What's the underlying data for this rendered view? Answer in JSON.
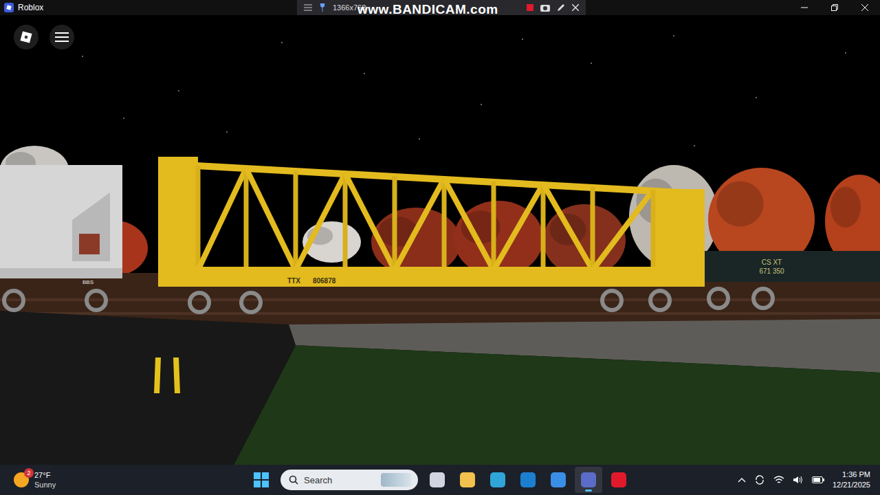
{
  "window": {
    "title": "Roblox"
  },
  "recorder": {
    "resolution": "1366x768",
    "watermark": "www.BANDICAM.com",
    "recording": true
  },
  "game": {
    "cars": [
      {
        "kind": "hopper",
        "mark": "BBS",
        "number": ""
      },
      {
        "kind": "centerbeam",
        "mark": "TTX",
        "number": "806878"
      },
      {
        "kind": "tank",
        "mark": "CS XT",
        "number": "671 350"
      }
    ]
  },
  "taskbar": {
    "weather": {
      "temp": "27°F",
      "condition": "Sunny",
      "badge": "2"
    },
    "search": {
      "placeholder": "Search"
    },
    "apps": [
      {
        "name": "task-view",
        "selected": false
      },
      {
        "name": "file-explorer",
        "selected": false
      },
      {
        "name": "edge",
        "selected": false
      },
      {
        "name": "hp",
        "selected": false
      },
      {
        "name": "store",
        "selected": false
      },
      {
        "name": "roblox",
        "selected": true
      },
      {
        "name": "bandicam",
        "selected": false
      }
    ],
    "clock": {
      "time": "1:36 PM",
      "date": "12/21/2025"
    }
  }
}
